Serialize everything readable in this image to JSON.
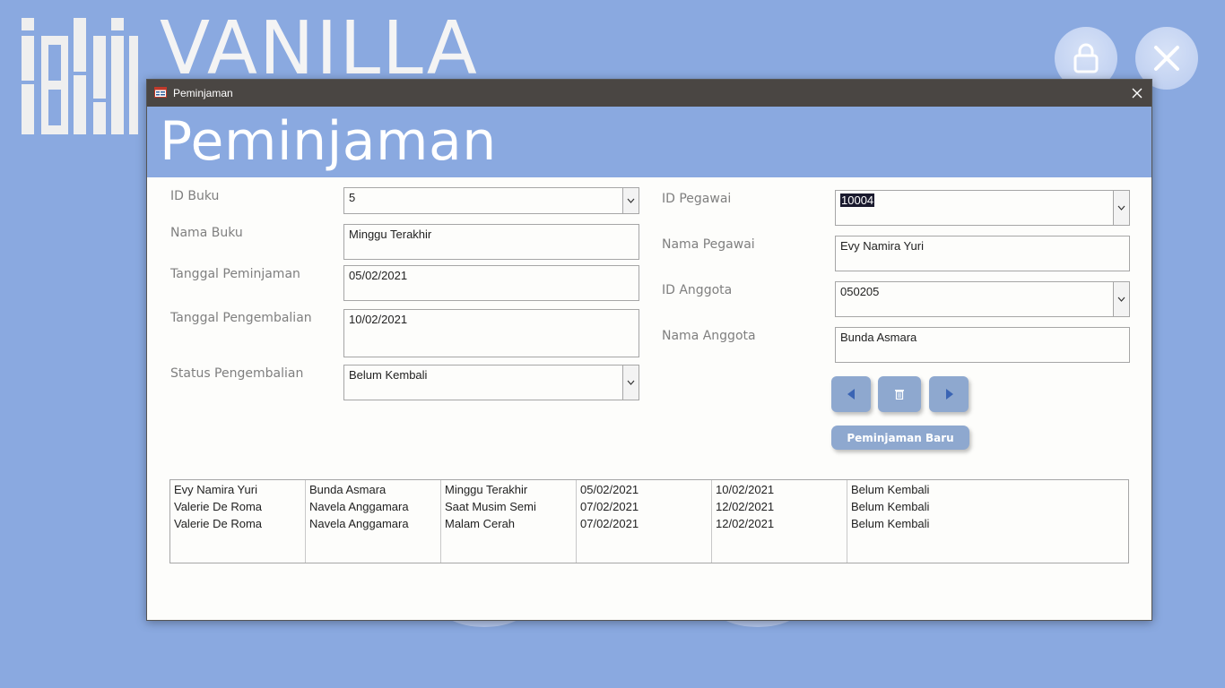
{
  "app": {
    "title": "VANILLA",
    "lock_icon": "lock-icon",
    "close_icon": "close-icon"
  },
  "window": {
    "title": "Peminjaman",
    "icon": "form-icon",
    "form_title": "Peminjaman"
  },
  "left_form": {
    "id_buku": {
      "label": "ID Buku",
      "value": "5"
    },
    "nama_buku": {
      "label": "Nama Buku",
      "value": "Minggu Terakhir"
    },
    "tanggal_peminjaman": {
      "label": "Tanggal Peminjaman",
      "value": "05/02/2021"
    },
    "tanggal_pengembalian": {
      "label": "Tanggal Pengembalian",
      "value": "10/02/2021"
    },
    "status_pengembalian": {
      "label": "Status Pengembalian",
      "value": "Belum Kembali"
    }
  },
  "right_form": {
    "id_pegawai": {
      "label": "ID Pegawai",
      "value": "10004"
    },
    "nama_pegawai": {
      "label": "Nama Pegawai",
      "value": "Evy Namira Yuri"
    },
    "id_anggota": {
      "label": "ID Anggota",
      "value": "050205"
    },
    "nama_anggota": {
      "label": "Nama Anggota",
      "value": "Bunda Asmara"
    }
  },
  "buttons": {
    "prev_icon": "triangle-left-icon",
    "delete_icon": "trash-icon",
    "next_icon": "triangle-right-icon",
    "new_label": "Peminjaman Baru"
  },
  "list": {
    "rows": [
      [
        "Evy Namira Yuri",
        "Bunda Asmara",
        "Minggu Terakhir",
        "05/02/2021",
        "10/02/2021",
        "Belum Kembali"
      ],
      [
        "Valerie De Roma",
        "Navela Anggamara",
        "Saat Musim Semi",
        "07/02/2021",
        "12/02/2021",
        "Belum Kembali"
      ],
      [
        "Valerie De Roma",
        "Navela Anggamara",
        "Malam Cerah",
        "07/02/2021",
        "12/02/2021",
        "Belum Kembali"
      ]
    ]
  },
  "colors": {
    "background": "#8aa9e0",
    "titlebar": "#4a4643",
    "button": "#8ea8cf"
  }
}
